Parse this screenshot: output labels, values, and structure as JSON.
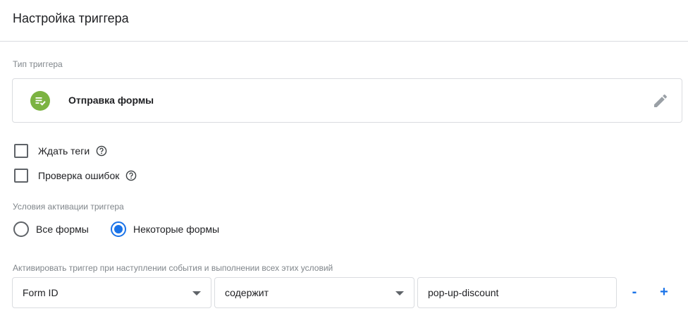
{
  "header": {
    "title": "Настройка триггера"
  },
  "trigger_type": {
    "label": "Тип триггера",
    "name": "Отправка формы",
    "icon": "form-submit-icon",
    "icon_color": "#7cb342"
  },
  "options": {
    "wait_tags": {
      "label": "Ждать теги",
      "checked": false
    },
    "check_errors": {
      "label": "Проверка ошибок",
      "checked": false
    }
  },
  "activation": {
    "label": "Условия активации триггера",
    "all_forms": {
      "label": "Все формы",
      "selected": false
    },
    "some_forms": {
      "label": "Некоторые формы",
      "selected": true
    }
  },
  "conditions": {
    "label": "Активировать триггер при наступлении события и выполнении всех этих условий",
    "rows": [
      {
        "variable": "Form ID",
        "operator": "содержит",
        "value": "pop-up-discount"
      }
    ],
    "remove_label": "-",
    "add_label": "+"
  },
  "colors": {
    "accent": "#1a73e8",
    "border": "#dadce0",
    "muted": "#80868b"
  }
}
